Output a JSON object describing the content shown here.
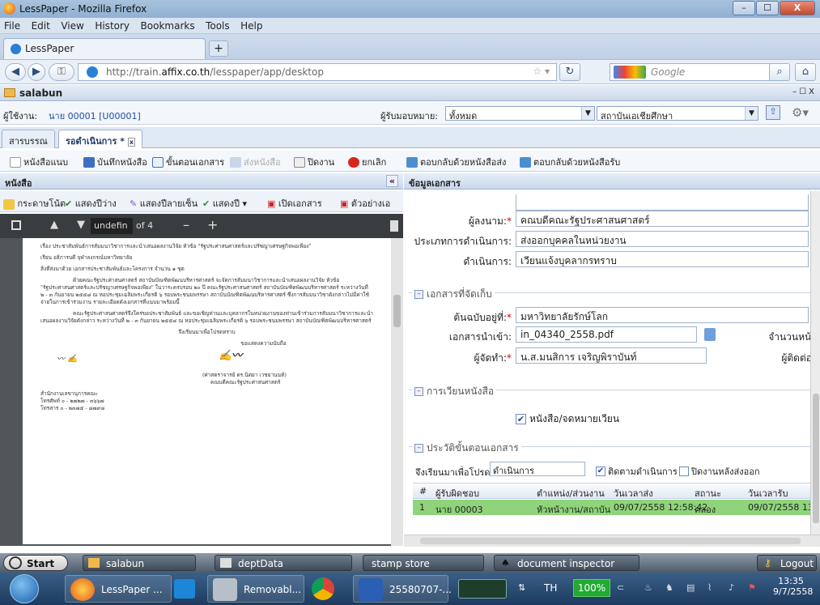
{
  "window": {
    "title": "LessPaper - Mozilla Firefox",
    "controls": [
      "–",
      "☐",
      "X"
    ]
  },
  "menu": [
    "File",
    "Edit",
    "View",
    "History",
    "Bookmarks",
    "Tools",
    "Help"
  ],
  "browser_tab": {
    "label": "LessPaper",
    "new_tab": "+"
  },
  "nav": {
    "url_prefix": "http://train.",
    "url_domain": "affix.co.th",
    "url_path": "/lesspaper/app/desktop",
    "search_placeholder": "Google"
  },
  "app": {
    "title": "salabun",
    "controls": [
      "–",
      "☐",
      "X"
    ]
  },
  "userbar": {
    "user_label": "ผู้ใช้งาน:",
    "user_value": "นาย 00001 [U00001]",
    "assign_label": "ผู้รับมอบหมาย:",
    "assign_value": "ทั้งหมด",
    "org_value": "สถาบันเอเชียศึกษา"
  },
  "tabs": [
    {
      "label": "สารบรรณ"
    },
    {
      "label": "รอดำเนินการ *"
    }
  ],
  "toolbar": {
    "attach": "หนังสือแนบ",
    "save": "บันทึกหนังสือ",
    "steps": "ขั้นตอนเอกสาร",
    "send": "ส่งหนังสือ",
    "close": "ปิดงาน",
    "cancel": "ยกเลิก",
    "reply_send": "ตอบกลับด้วยหนังสือส่ง",
    "reply_recv": "ตอบกลับด้วยหนังสือรับ"
  },
  "left_panel": {
    "title": "หนังสือ",
    "collapse": "«",
    "tools": [
      "กระดาษโน้ต",
      "แสดงปีว่าง",
      "แสดงปีลายเซ็น",
      "แสดงปี ▾",
      "เปิดเอกสาร",
      "ตัวอย่างเอ"
    ]
  },
  "viewer": {
    "page_input": "undefin",
    "of_pages": "of 4",
    "zoom_out": "–",
    "zoom_in": "+"
  },
  "paper": {
    "lines": [
      "เรื่อง   ประชาสัมพันธ์การสัมมนาวิชาการและนำเสนอผลงานวิจัย หัวข้อ \"รัฐประศาสนศาสตร์และปรัชญาเศรษฐกิจพอเพียง\"",
      "เรียน   อธิการบดี จุฬาลงกรณ์มหาวิทยาลัย",
      "สิ่งที่ส่งมาด้วย  เอกสารประชาสัมพันธ์และโครงการ จำนวน ๑ ชุด",
      "ด้วยคณะรัฐประศาสนศาสตร์ สถาบันบัณฑิตพัฒนบริหารศาสตร์ จะจัดการสัมมนาวิชาการและนำเสนอผลงานวิจัย หัวข้อ \"รัฐประศาสนศาสตร์และปรัชญาเศรษฐกิจพอเพียง\" ในวาระครบรอบ ๒๐ ปี คณะรัฐประศาสนศาสตร์ สถาบันบัณฑิตพัฒนบริหารศาสตร์ ระหว่างวันที่ ๒ - ๓ กันยายน ๒๕๕๘ ณ หอประชุมเฉลิมพระเกียรติ ๖ รอบพระชนมพรรษา สถาบันบัณฑิตพัฒนบริหารศาสตร์  ซึ่งการสัมมนาวิชาดังกล่าวไม่มีค่าใช้จ่ายในการเข้าร่วมงาน รายละเอียดดังเอกสารที่แนบมาพร้อมนี้",
      "คณะรัฐประศาสนศาสตร์จึงใคร่ขอประชาสัมพันธ์ และขอเชิญท่านและบุคลากรในหน่วยงานของท่านเข้าร่วมการสัมมนาวิชาการและนำเสนอผลงานวิจัยดังกล่าว ระหว่างวันที่ ๒ - ๓ กันยายน ๒๕๕๘ ณ หอประชุมเฉลิมพระเกียรติ ๖ รอบพระชนมพรรษา สถาบันบัณฑิตพัฒนบริหารศาสตร์",
      "จึงเรียนมาเพื่อโปรดทราบ",
      "ขอแสดงความนับถือ",
      "(ศาสตราจารย์ ดร.นิตยา เวชยานนท์)",
      "คณบดีคณะรัฐประศาสนศาสตร์",
      "สำนักงานเลขานุการคณะ",
      "โทรศัพท์ ๐ - ๒๗๒๗ - ๓๖๖๗",
      "โทรสาร ๐ - ๒๓๗๕ - ๘๗๙๘"
    ]
  },
  "right_panel": {
    "title": "ข้อมูลเอกสาร",
    "fields": {
      "signer_label": "ผู้ลงนาม:",
      "signer_value": "คณบดีคณะรัฐประศาสนศาสตร์",
      "action_type_label": "ประเภทการดำเนินการ:",
      "action_type_value": "ส่งออกบุคคลในหน่วยงาน",
      "action_label": "ดำเนินการ:",
      "action_value": "เวียนแจ้งบุคลากรทราบ"
    },
    "storage": {
      "legend": "เอกสารที่จัดเก็บ",
      "origin_label": "ต้นฉบับอยู่ที่:",
      "origin_value": "มหาวิทยาลัยรักษ์โลก",
      "import_label": "เอกสารนำเข้า:",
      "import_value": "in_04340_2558.pdf",
      "pages_label": "จำนวนหน้า:",
      "creator_label": "ผู้จัดทำ:",
      "creator_value": "น.ส.มนสิการ เจริญพิราบันท์",
      "contact_label": "ผู้ติดต่อ:"
    },
    "circulation": {
      "legend": "การเวียนหนังสือ",
      "checkbox_label": "หนังสือ/จดหมายเวียน"
    },
    "history": {
      "legend": "ประวัติขั้นตอนเอกสาร",
      "filter_label": "จึงเรียนมาเพื่อโปรด:",
      "filter_value": "ดำเนินการ",
      "follow_label": "ติดตามดำเนินการ",
      "closed_label": "ปิดงานหลังส่งออก",
      "columns": [
        "#",
        "ผู้รับผิดชอบ",
        "ตำแหน่ง/ส่วนงาน",
        "วันเวลาส่ง",
        "สถานะ",
        "วันเวลารับ"
      ],
      "rows": [
        [
          "1",
          "นาย 00003",
          "หัวหน้างาน/สถาบัน",
          "09/07/2558 12:58:42",
          "คลอง",
          "09/07/2558 13:0"
        ]
      ]
    }
  },
  "taskbar_top": {
    "start": "Start",
    "items": [
      "salabun",
      "deptData",
      "stamp store",
      "document inspector"
    ],
    "logout": "Logout"
  },
  "taskbar_win": {
    "items": [
      "LessPaper ...",
      "Removabl...",
      "25580707-..."
    ],
    "lang": "TH",
    "battery": "100%",
    "time": "13:35",
    "date": "9/7/2558"
  }
}
